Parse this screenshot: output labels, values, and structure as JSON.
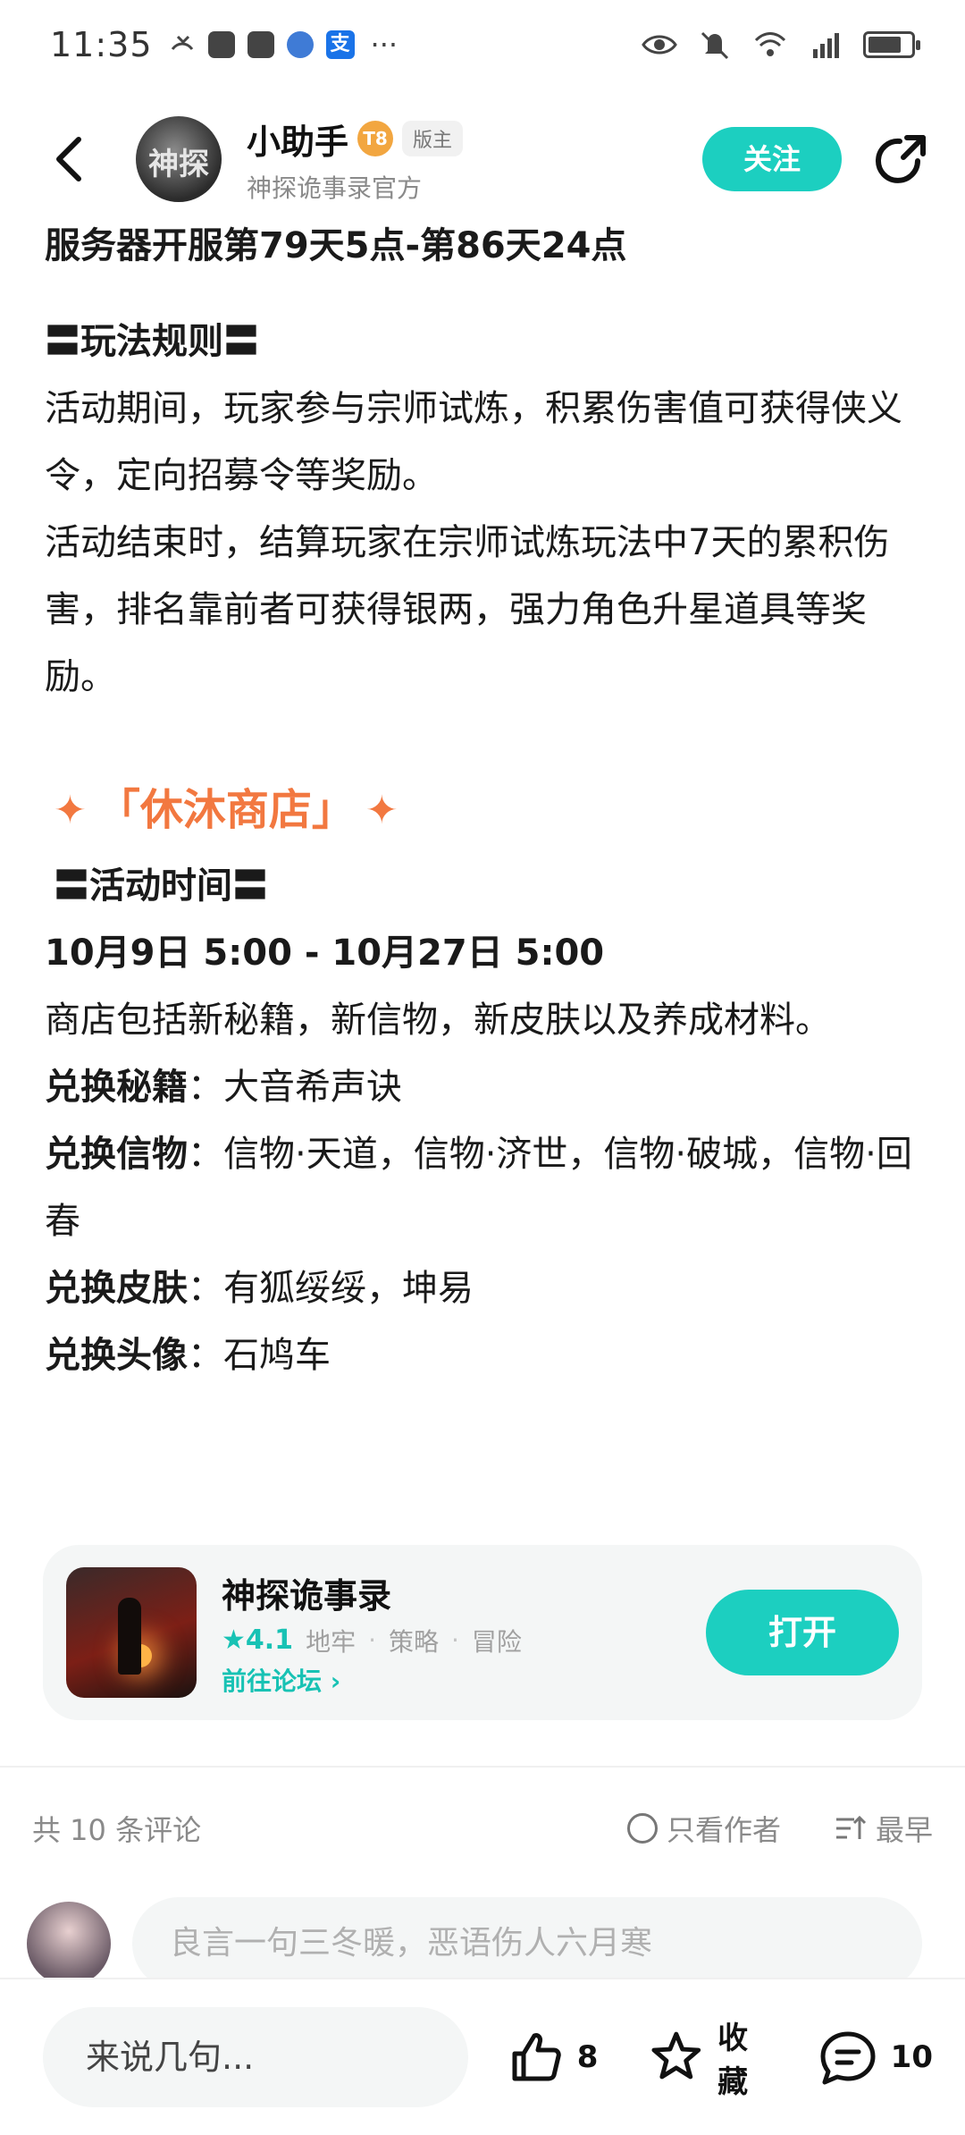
{
  "status_bar": {
    "time": "11:35",
    "network": "5G",
    "icons": [
      "missed-call-icon",
      "app-icon",
      "app-icon",
      "browser-icon",
      "alipay-icon",
      "more-icon",
      "eye-icon",
      "mute-icon",
      "wifi-icon",
      "signal-icon",
      "battery-icon"
    ],
    "alipay_glyph": "支",
    "more": "···"
  },
  "header": {
    "nickname": "小助手",
    "level": "8",
    "level_prefix": "T",
    "badge": "版主",
    "subtitle": "神探诡事录官方",
    "follow_label": "关注",
    "avatar_glyph": "神探"
  },
  "article": {
    "server_time": "服务器开服第79天5点-第86天24点",
    "rules_heading": "〓玩法规则〓",
    "rules_p1": "活动期间，玩家参与宗师试炼，积累伤害值可获得侠义令，定向招募令等奖励。",
    "rules_p2": "活动结束时，结算玩家在宗师试炼玩法中7天的累积伤害，排名靠前者可获得银两，强力角色升星道具等奖励。",
    "shop_title": "「休沐商店」",
    "shop_time_heading": "〓活动时间〓",
    "shop_time": "10月9日 5:00 - 10月27日 5:00",
    "shop_desc": "商店包括新秘籍，新信物，新皮肤以及养成材料。",
    "items": [
      {
        "label": "兑换秘籍",
        "value": "大音希声诀"
      },
      {
        "label": "兑换信物",
        "value": "信物·天道，信物·济世，信物·破城，信物·回春"
      },
      {
        "label": "兑换皮肤",
        "value": "有狐绥绥，坤易"
      },
      {
        "label": "兑换头像",
        "value": "石鸠车"
      }
    ],
    "colon": "："
  },
  "app_card": {
    "name": "神探诡事录",
    "rating": "4.1",
    "tags": [
      "地牢",
      "策略",
      "冒险"
    ],
    "forum_link": "前往论坛",
    "open_label": "打开",
    "separator": "·"
  },
  "comments": {
    "count_text": "共 10 条评论",
    "only_author": "只看作者",
    "sort": "最早",
    "input_placeholder": "良言一句三冬暖，恶语伤人六月寒"
  },
  "bottom_bar": {
    "say_placeholder": "来说几句...",
    "likes": "8",
    "favorite_label": "收藏",
    "comments": "10"
  },
  "colors": {
    "accent": "#1ccfc0",
    "section_title": "#f27840",
    "muted": "#8a8a8a"
  }
}
